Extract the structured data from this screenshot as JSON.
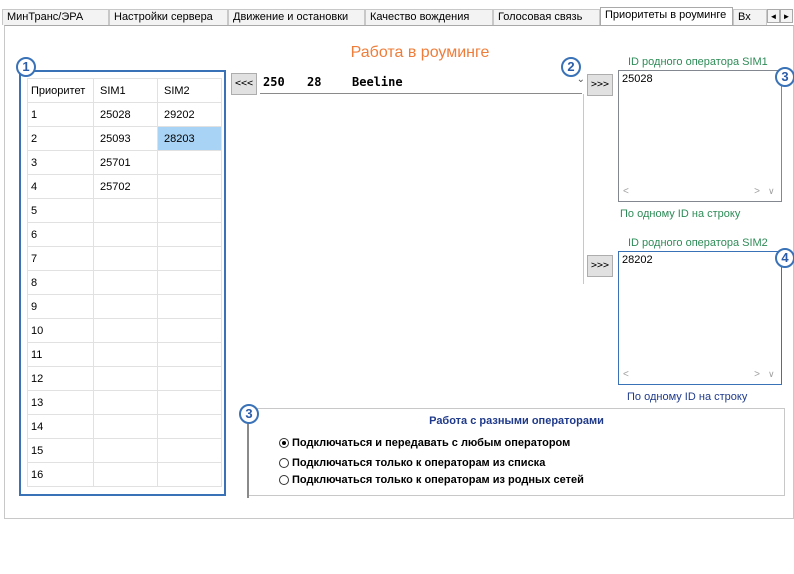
{
  "tabs": [
    {
      "label": "МинТранс/ЭРА"
    },
    {
      "label": "Настройки сервера"
    },
    {
      "label": "Движение и остановки"
    },
    {
      "label": "Качество вождения"
    },
    {
      "label": "Голосовая связь"
    },
    {
      "label": "Приоритеты в роуминге"
    },
    {
      "label": "Вх"
    }
  ],
  "tab_scroll": {
    "left": "◄",
    "right": "►"
  },
  "badges": {
    "b1": "1",
    "b2": "2",
    "b3a": "3",
    "b4": "4",
    "b3b": "3"
  },
  "priority_table": {
    "headers": [
      "Приоритет",
      "SIM1",
      "SIM2"
    ],
    "rows": [
      [
        "1",
        "25028",
        "29202"
      ],
      [
        "2",
        "25093",
        "28203"
      ],
      [
        "3",
        "25701",
        ""
      ],
      [
        "4",
        "25702",
        ""
      ],
      [
        "5",
        "",
        ""
      ],
      [
        "6",
        "",
        ""
      ],
      [
        "7",
        "",
        ""
      ],
      [
        "8",
        "",
        ""
      ],
      [
        "9",
        "",
        ""
      ],
      [
        "10",
        "",
        ""
      ],
      [
        "11",
        "",
        ""
      ],
      [
        "12",
        "",
        ""
      ],
      [
        "13",
        "",
        ""
      ],
      [
        "14",
        "",
        ""
      ],
      [
        "15",
        "",
        ""
      ],
      [
        "16",
        "",
        ""
      ]
    ]
  },
  "roaming": {
    "title": "Работа в роуминге",
    "left_button": "<<<",
    "operator": {
      "mcc": "250",
      "mnc": "28",
      "name": "Beeline"
    },
    "to_sim1_button": ">>>",
    "to_sim2_button": ">>>"
  },
  "sim1": {
    "label": "ID родного оператора SIM1",
    "value": "25028",
    "hint": "По одному ID на строку"
  },
  "sim2": {
    "label": "ID родного оператора SIM2",
    "value": "28202",
    "hint": "По одному ID на строку"
  },
  "operators_group": {
    "title": "Работа с разными операторами",
    "options": [
      {
        "label": "Подключаться и передавать с любым оператором",
        "selected": true
      },
      {
        "label": "Подключаться только к операторам из списка",
        "selected": false
      },
      {
        "label": "Подключаться только к операторам из родных сетей",
        "selected": false
      }
    ]
  }
}
